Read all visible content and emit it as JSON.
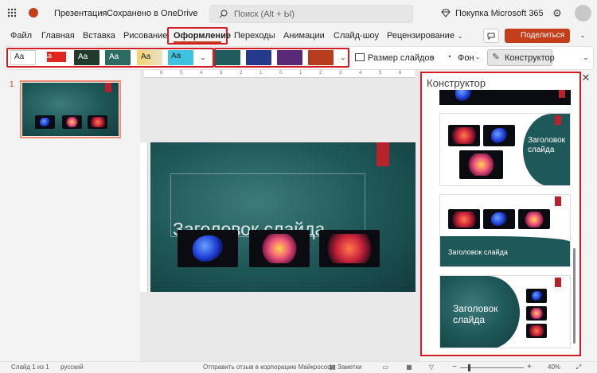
{
  "titlebar": {
    "doc_title": "Презентация",
    "save_status": "Сохранено в OneDrive",
    "search_placeholder": "Поиск (Alt + Ы)",
    "buy_label": "Покупка Microsoft 365"
  },
  "tabs": [
    "Файл",
    "Главная",
    "Вставка",
    "Рисование",
    "Оформление",
    "Переходы",
    "Анимации",
    "Слайд-шоу",
    "Рецензирование"
  ],
  "active_tab": "Оформление",
  "share_label": "Поделиться",
  "ribbon": {
    "theme_sample": "Aa",
    "slide_size_label": "Размер слайдов",
    "background_label": "Фон",
    "designer_label": "Конструктор"
  },
  "slides_panel": {
    "number": "1"
  },
  "slide": {
    "title_placeholder": "Заголовок слайда"
  },
  "designer": {
    "title": "Конструктор",
    "option1_title": "Заголовок слайда",
    "option2_title": "Заголовок слайда",
    "option3_title": "Заголовок слайда"
  },
  "ruler_ticks": [
    "6",
    "5",
    "4",
    "3",
    "2",
    "1",
    "0",
    "1",
    "2",
    "3",
    "4",
    "5",
    "6"
  ],
  "statusbar": {
    "slide_info": "Слайд 1 из 1",
    "language": "русский",
    "feedback": "Отправить отзыв в корпорацию Майкрософт",
    "notes": "Заметки",
    "zoom": "40%"
  },
  "colors": {
    "accent": "#c43e1c",
    "highlight": "#d31d25",
    "teal": "#1f5858",
    "red_tag": "#b8232b"
  }
}
